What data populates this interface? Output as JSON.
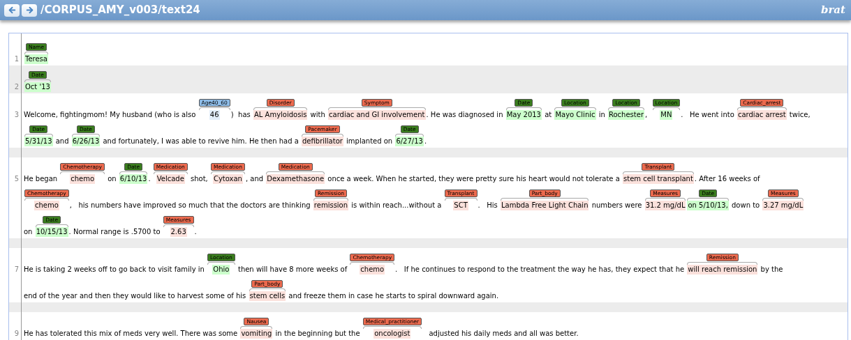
{
  "header": {
    "title": "/CORPUS_AMY_v003/text24",
    "logo": "brat"
  },
  "sentences": [
    {
      "kind": "text",
      "number": "1",
      "lines": [
        [
          {
            "kind": "annotation",
            "label": "Name",
            "text": "Teresa",
            "color": "#3a7d1e"
          }
        ]
      ]
    },
    {
      "kind": "text",
      "number": "2",
      "lines": [
        [
          {
            "kind": "annotation",
            "label": "Date",
            "text": "Oct '13",
            "color": "#3a7d1e"
          }
        ]
      ]
    },
    {
      "kind": "text",
      "number": "3",
      "lines": [
        [
          {
            "kind": "plain",
            "text": "Welcome, fightingmom! My husband (who is also "
          },
          {
            "kind": "annotation",
            "label": "Age40_60",
            "text": "46",
            "color": "#8fbde8"
          },
          {
            "kind": "plain",
            "text": ")  has "
          },
          {
            "kind": "annotation",
            "label": "Disorder",
            "text": "AL Amyloidosis",
            "color": "#ec6a4e"
          },
          {
            "kind": "plain",
            "text": " with "
          },
          {
            "kind": "annotation",
            "label": "Symptom",
            "text": "cardiac and GI involvement",
            "color": "#ec6a4e"
          },
          {
            "kind": "plain",
            "text": ". He was diagnosed in "
          },
          {
            "kind": "annotation",
            "label": "Date",
            "text": "May 2013",
            "color": "#3a7d1e"
          },
          {
            "kind": "plain",
            "text": " at "
          },
          {
            "kind": "annotation",
            "label": "Location",
            "text": "Mayo Clinic",
            "color": "#3a7d1e"
          },
          {
            "kind": "plain",
            "text": " in "
          },
          {
            "kind": "annotation",
            "label": "Location",
            "text": "Rochester",
            "color": "#3a7d1e"
          },
          {
            "kind": "plain",
            "text": ",  "
          },
          {
            "kind": "annotation",
            "label": "Location",
            "text": "MN",
            "color": "#3a7d1e"
          },
          {
            "kind": "plain",
            "text": ".   He went into "
          },
          {
            "kind": "annotation",
            "label": "Cardiac_arrest",
            "text": "cardiac arrest",
            "color": "#ec6a4e"
          },
          {
            "kind": "plain",
            "text": " twice,"
          }
        ],
        [
          {
            "kind": "annotation",
            "label": "Date",
            "text": "5/31/13",
            "color": "#3a7d1e"
          },
          {
            "kind": "plain",
            "text": " and "
          },
          {
            "kind": "annotation",
            "label": "Date",
            "text": "6/26/13",
            "color": "#3a7d1e"
          },
          {
            "kind": "plain",
            "text": " and fortunately, I was able to revive him. He then had a "
          },
          {
            "kind": "annotation",
            "label": "Pacemaker",
            "text": "defibrillator",
            "color": "#ec6a4e"
          },
          {
            "kind": "plain",
            "text": " implanted on "
          },
          {
            "kind": "annotation",
            "label": "Date",
            "text": "6/27/13",
            "color": "#3a7d1e"
          },
          {
            "kind": "plain",
            "text": "."
          }
        ]
      ]
    },
    {
      "kind": "blank"
    },
    {
      "kind": "text",
      "number": "5",
      "lines": [
        [
          {
            "kind": "plain",
            "text": "He began "
          },
          {
            "kind": "annotation",
            "label": "Chemotherapy",
            "text": "chemo",
            "color": "#ec6a4e"
          },
          {
            "kind": "plain",
            "text": " on "
          },
          {
            "kind": "annotation",
            "label": "Date",
            "text": "6/10/13",
            "color": "#3a7d1e"
          },
          {
            "kind": "plain",
            "text": ". "
          },
          {
            "kind": "annotation",
            "label": "Medication",
            "text": "Velcade",
            "color": "#ec6a4e"
          },
          {
            "kind": "plain",
            "text": " shot, "
          },
          {
            "kind": "annotation",
            "label": "Medication",
            "text": "Cytoxan",
            "color": "#ec6a4e"
          },
          {
            "kind": "plain",
            "text": ", and "
          },
          {
            "kind": "annotation",
            "label": "Medication",
            "text": "Dexamethasone",
            "color": "#ec6a4e"
          },
          {
            "kind": "plain",
            "text": " once a week. When he started, they were pretty sure his heart would not tolerate a "
          },
          {
            "kind": "annotation",
            "label": "Transplant",
            "text": "stem cell transplant",
            "color": "#ec6a4e"
          },
          {
            "kind": "plain",
            "text": ". After 16 weeks of"
          }
        ],
        [
          {
            "kind": "annotation",
            "label": "Chemotherapy",
            "text": "chemo",
            "color": "#ec6a4e"
          },
          {
            "kind": "plain",
            "text": ",   his numbers have improved so much that the doctors are thinking "
          },
          {
            "kind": "annotation",
            "label": "Remission",
            "text": "remission",
            "color": "#ec6a4e"
          },
          {
            "kind": "plain",
            "text": " is within reach...without a "
          },
          {
            "kind": "annotation",
            "label": "Transplant",
            "text": "SCT",
            "color": "#ec6a4e"
          },
          {
            "kind": "plain",
            "text": ".   His "
          },
          {
            "kind": "annotation",
            "label": "Part_body",
            "text": "Lambda Free Light Chain",
            "color": "#ec6a4e"
          },
          {
            "kind": "plain",
            "text": " numbers were "
          },
          {
            "kind": "annotation",
            "label": "Measures",
            "text": "31.2 mg/dL",
            "color": "#ec6a4e"
          },
          {
            "kind": "annotation",
            "label": "Date",
            "text": "on 5/10/13,",
            "color": "#3a7d1e"
          },
          {
            "kind": "plain",
            "text": " down to "
          },
          {
            "kind": "annotation",
            "label": "Measures",
            "text": "3.27 mg/dL",
            "color": "#ec6a4e"
          }
        ],
        [
          {
            "kind": "plain",
            "text": "on "
          },
          {
            "kind": "annotation",
            "label": "Date",
            "text": "10/15/13",
            "color": "#3a7d1e"
          },
          {
            "kind": "plain",
            "text": ". Normal range is .5700 to "
          },
          {
            "kind": "annotation",
            "label": "Measures",
            "text": "2.63",
            "color": "#ec6a4e"
          },
          {
            "kind": "plain",
            "text": "."
          }
        ]
      ]
    },
    {
      "kind": "blank"
    },
    {
      "kind": "text",
      "number": "7",
      "lines": [
        [
          {
            "kind": "plain",
            "text": "He is taking 2 weeks off to go back to visit family in "
          },
          {
            "kind": "annotation",
            "label": "Location",
            "text": "Ohio",
            "color": "#3a7d1e"
          },
          {
            "kind": "plain",
            "text": " then will have 8 more weeks of "
          },
          {
            "kind": "annotation",
            "label": "Chemotherapy",
            "text": "chemo",
            "color": "#ec6a4e"
          },
          {
            "kind": "plain",
            "text": ".   If he continues to respond to the treatment the way he has, they expect that he "
          },
          {
            "kind": "annotation",
            "label": "Remission",
            "text": "will reach remission",
            "color": "#ec6a4e"
          },
          {
            "kind": "plain",
            "text": " by the"
          }
        ],
        [
          {
            "kind": "plain",
            "text": "end of the year and then they would like to harvest some of his "
          },
          {
            "kind": "annotation",
            "label": "Part_body",
            "text": "stem cells",
            "color": "#ec6a4e"
          },
          {
            "kind": "plain",
            "text": " and freeze them in case he starts to spiral downward again."
          }
        ]
      ]
    },
    {
      "kind": "blank"
    },
    {
      "kind": "text",
      "number": "9",
      "lines": [
        [
          {
            "kind": "plain",
            "text": "He has tolerated this mix of meds very well. There was some "
          },
          {
            "kind": "annotation",
            "label": "Nausea",
            "text": "vomiting",
            "color": "#ec6a4e"
          },
          {
            "kind": "plain",
            "text": " in the beginning but the "
          },
          {
            "kind": "annotation",
            "label": "Medical_practitioner",
            "text": "oncologist",
            "color": "#ec6a4e"
          },
          {
            "kind": "plain",
            "text": "   adjusted his daily meds and all was better."
          }
        ]
      ]
    }
  ]
}
